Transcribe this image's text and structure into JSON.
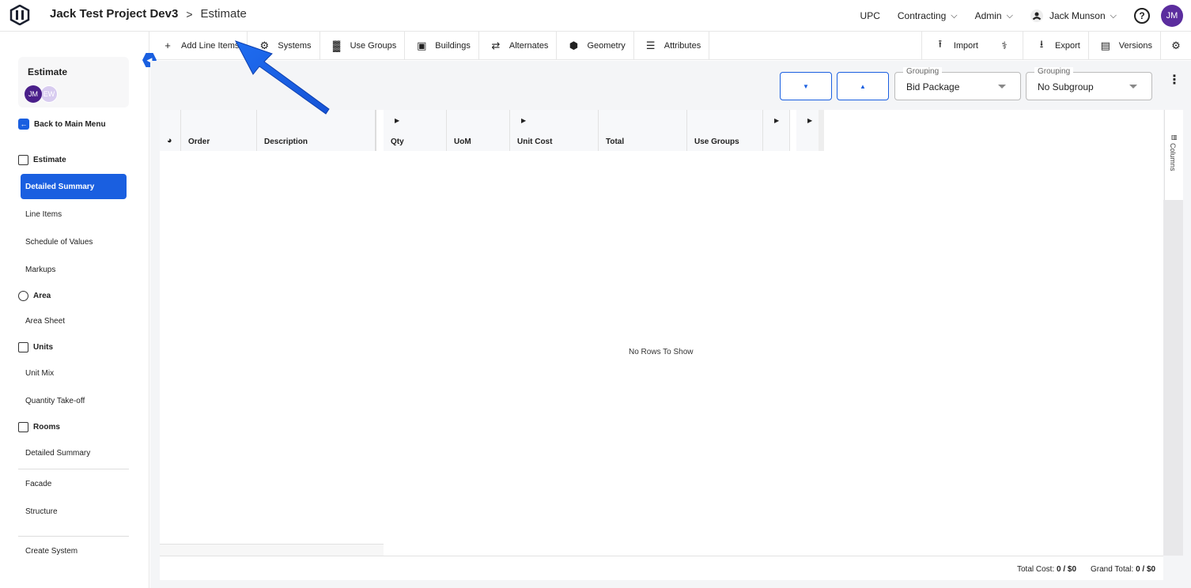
{
  "header": {
    "project": "Jack Test Project Dev3",
    "separator": ">",
    "page": "Estimate",
    "nav": [
      {
        "label": "UPC",
        "chevron": false
      },
      {
        "label": "Contracting",
        "chevron": true
      },
      {
        "label": "Admin",
        "chevron": true
      }
    ],
    "user": "Jack Munson",
    "avatar_initials": "JM",
    "help_glyph": "?"
  },
  "toolbar": {
    "add_line_items": "Add Line Items",
    "systems": "Systems",
    "use_groups": "Use Groups",
    "buildings": "Buildings",
    "alternates": "Alternates",
    "geometry": "Geometry",
    "attributes": "Attributes",
    "import": "Import",
    "export": "Export",
    "versions": "Versions"
  },
  "sidebar": {
    "card_title": "Estimate",
    "avatars": [
      "JM",
      "EW"
    ],
    "back": "Back to Main Menu",
    "sections": {
      "estimate": "Estimate",
      "area": "Area",
      "units": "Units",
      "rooms": "Rooms"
    },
    "items": {
      "detailed_summary": "Detailed Summary",
      "line_items": "Line Items",
      "schedule_of_values": "Schedule of Values",
      "markups": "Markups",
      "area_sheet": "Area Sheet",
      "unit_mix": "Unit Mix",
      "quantity_takeoff": "Quantity Take-off",
      "rooms_detailed_summary": "Detailed Summary",
      "facade": "Facade",
      "structure": "Structure",
      "create_system": "Create System"
    }
  },
  "controls": {
    "grouping_label": "Grouping",
    "grouping_value": "Bid Package",
    "subgroup_label": "Grouping",
    "subgroup_value": "No Subgroup"
  },
  "grid": {
    "columns": [
      "Order",
      "Description",
      "Qty",
      "UoM",
      "Unit Cost",
      "Total",
      "Use Groups"
    ],
    "empty_message": "No Rows To Show",
    "side_panel": "Columns"
  },
  "footer": {
    "total_cost_label": "Total Cost:",
    "total_cost_value": "0 / $0",
    "grand_total_label": "Grand Total:",
    "grand_total_value": "0 / $0"
  },
  "colors": {
    "accent": "#1a5fe0",
    "avatar": "#5b2d9e"
  }
}
